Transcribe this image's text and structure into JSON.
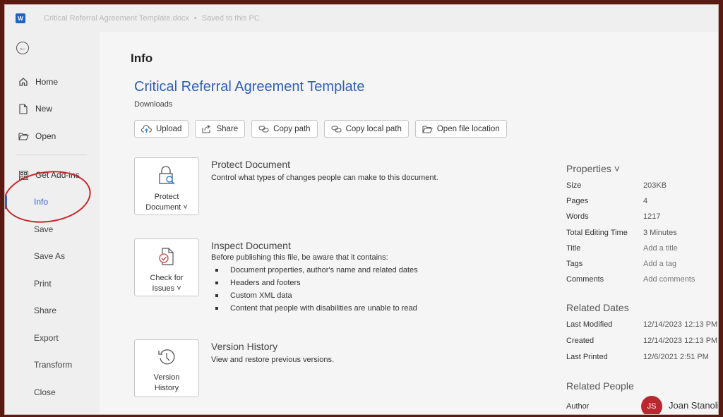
{
  "window": {
    "title": "Critical Referral Agreement Template.docx",
    "save_status": "Saved to this PC",
    "separator": "•",
    "app_icon_letter": "W"
  },
  "sidebar": {
    "back_icon": "back-arrow-icon",
    "items": [
      {
        "label": "Home",
        "icon": "home-icon"
      },
      {
        "label": "New",
        "icon": "new-document-icon"
      },
      {
        "label": "Open",
        "icon": "folder-open-icon"
      },
      {
        "label": "Get Add-ins",
        "icon": "add-ins-grid-icon"
      },
      {
        "label": "Info",
        "active": true
      },
      {
        "label": "Save"
      },
      {
        "label": "Save As"
      },
      {
        "label": "Print"
      },
      {
        "label": "Share"
      },
      {
        "label": "Export"
      },
      {
        "label": "Transform"
      },
      {
        "label": "Close"
      }
    ]
  },
  "main": {
    "page_title": "Info",
    "document_title": "Critical Referral Agreement Template",
    "location": "Downloads",
    "actions": [
      {
        "label": "Upload",
        "icon": "cloud-upload-icon"
      },
      {
        "label": "Share",
        "icon": "share-icon"
      },
      {
        "label": "Copy path",
        "icon": "link-icon"
      },
      {
        "label": "Copy local path",
        "icon": "link-icon"
      },
      {
        "label": "Open file location",
        "icon": "folder-open-icon"
      }
    ],
    "sections": [
      {
        "tile_label_1": "Protect",
        "tile_label_2": "Document ˅",
        "heading": "Protect Document",
        "description": "Control what types of changes people can make to this document."
      },
      {
        "tile_label_1": "Check for",
        "tile_label_2": "Issues ˅",
        "heading": "Inspect Document",
        "description": "Before publishing this file, be aware that it contains:",
        "bullets": [
          "Document properties, author's name and related dates",
          "Headers and footers",
          "Custom XML data",
          "Content that people with disabilities are unable to read"
        ]
      },
      {
        "tile_label_1": "Version",
        "tile_label_2": "History",
        "heading": "Version History",
        "description": "View and restore previous versions."
      }
    ]
  },
  "properties": {
    "heading": "Properties ˅",
    "rows": [
      {
        "key": "Size",
        "value": "203KB"
      },
      {
        "key": "Pages",
        "value": "4"
      },
      {
        "key": "Words",
        "value": "1217"
      },
      {
        "key": "Total Editing Time",
        "value": "3 Minutes"
      },
      {
        "key": "Title",
        "value": "Add a title"
      },
      {
        "key": "Tags",
        "value": "Add a tag"
      },
      {
        "key": "Comments",
        "value": "Add comments"
      }
    ],
    "dates_heading": "Related Dates",
    "dates": [
      {
        "key": "Last Modified",
        "value": "12/14/2023 12:13 PM"
      },
      {
        "key": "Created",
        "value": "12/14/2023 12:13 PM"
      },
      {
        "key": "Last Printed",
        "value": "12/6/2021 2:51 PM"
      }
    ],
    "people_heading": "Related People",
    "author_label": "Author",
    "author_initials": "JS",
    "author_name": "Joan Stanolis"
  },
  "colors": {
    "accent": "#3a63b5",
    "title_blue": "#2f5fb3",
    "avatar": "#b52a2f",
    "annotation": "#c8262a",
    "frame": "#5a1a12"
  }
}
